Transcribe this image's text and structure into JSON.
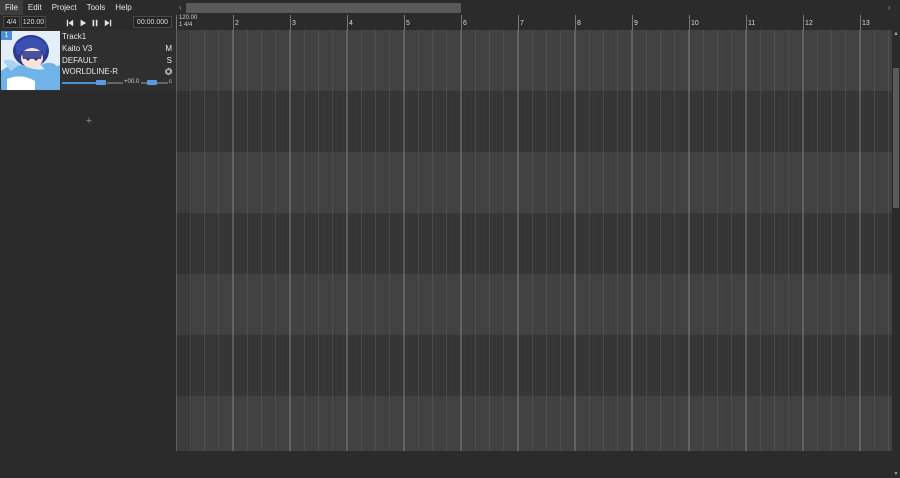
{
  "menu": {
    "items": [
      {
        "label": "File"
      },
      {
        "label": "Edit"
      },
      {
        "label": "Project"
      },
      {
        "label": "Tools"
      },
      {
        "label": "Help"
      }
    ]
  },
  "transport": {
    "time_signature": "4/4",
    "bpm": "120.00",
    "position": "00:00.000"
  },
  "track": {
    "number": "1",
    "name": "Track1",
    "singer": "Kaito V3",
    "phonemizer": "DEFAULT",
    "renderer": "WORLDLINE-R",
    "mute_label": "M",
    "solo_label": "S",
    "volume_readout": "+00.0",
    "pan_readout": "c"
  },
  "ruler": {
    "tempo": "120.00",
    "timesig": "1 4/4",
    "bars": [
      "2",
      "3",
      "4",
      "5",
      "6",
      "7",
      "8",
      "9",
      "10",
      "11",
      "12",
      "13"
    ]
  },
  "colors": {
    "accent": "#4a90d9",
    "lane_light": "#414141",
    "lane_dark": "#353535",
    "background": "#2b2b2b"
  }
}
